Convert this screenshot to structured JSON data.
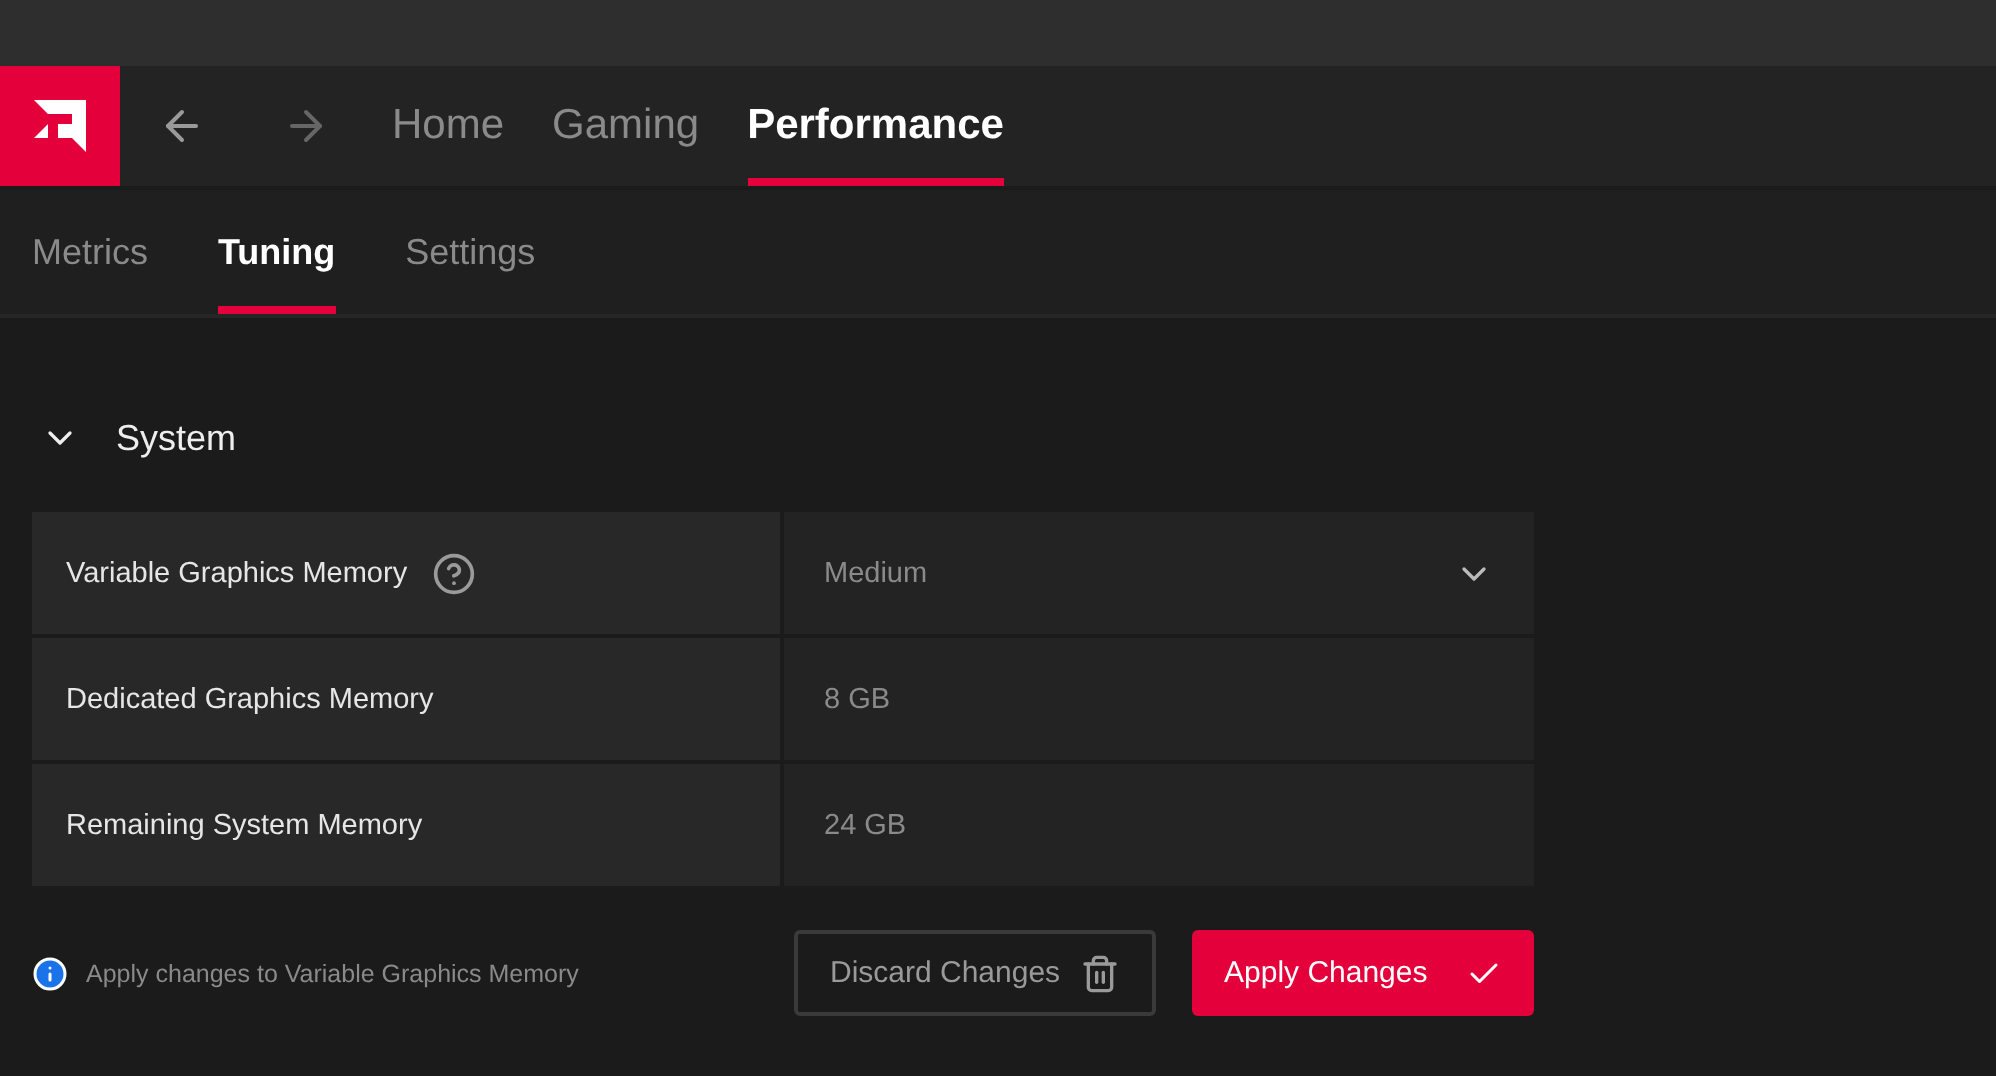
{
  "nav": {
    "tabs": [
      {
        "label": "Home",
        "selected": false
      },
      {
        "label": "Gaming",
        "selected": false
      },
      {
        "label": "Performance",
        "selected": true
      }
    ]
  },
  "subtabs": [
    {
      "label": "Metrics",
      "selected": false
    },
    {
      "label": "Tuning",
      "selected": true
    },
    {
      "label": "Settings",
      "selected": false
    }
  ],
  "section": {
    "title": "System",
    "expanded": true,
    "rows": [
      {
        "kind": "dropdown",
        "label": "Variable Graphics Memory",
        "help": true,
        "value": "Medium"
      },
      {
        "kind": "value",
        "label": "Dedicated Graphics Memory",
        "help": false,
        "value": "8 GB"
      },
      {
        "kind": "value",
        "label": "Remaining System Memory",
        "help": false,
        "value": "24 GB"
      }
    ]
  },
  "footer": {
    "info": "Apply changes to Variable Graphics Memory",
    "discard": "Discard Changes",
    "apply": "Apply Changes"
  }
}
